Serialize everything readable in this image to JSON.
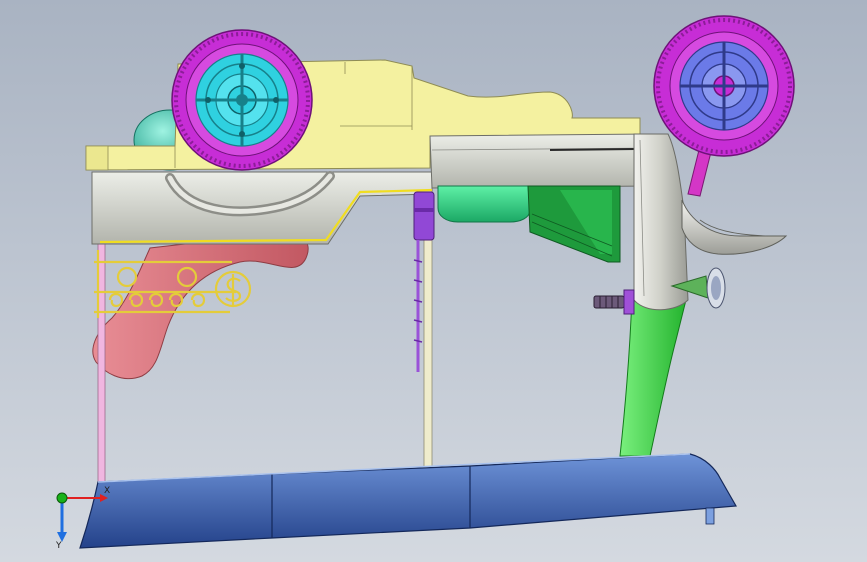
{
  "viewport": {
    "background_top": "#a9b3c2",
    "background_bottom": "#d4d9e0"
  },
  "triad": {
    "x_label": "X",
    "y_label": "Y",
    "x_color": "#e02020",
    "y_color": "#1f6fe0",
    "z_color": "#19b219"
  },
  "colors": {
    "body_yellow": "#f4f1a0",
    "frame_grey": "#c9cbc4",
    "wheel_magenta": "#c72dd6",
    "hub_cyan": "#2fd1e0",
    "hub_blue": "#6b7ae8",
    "skid_blue": "#3d64b4",
    "leg_green": "#3fe04a",
    "tank_green": "#33d68c",
    "dark_green": "#1f8a3a",
    "handle_pink": "#d9707a",
    "scroll_gold": "#e9d24a",
    "knob_teal": "#35c7b0",
    "actuator_purple": "#8a3fd0"
  }
}
